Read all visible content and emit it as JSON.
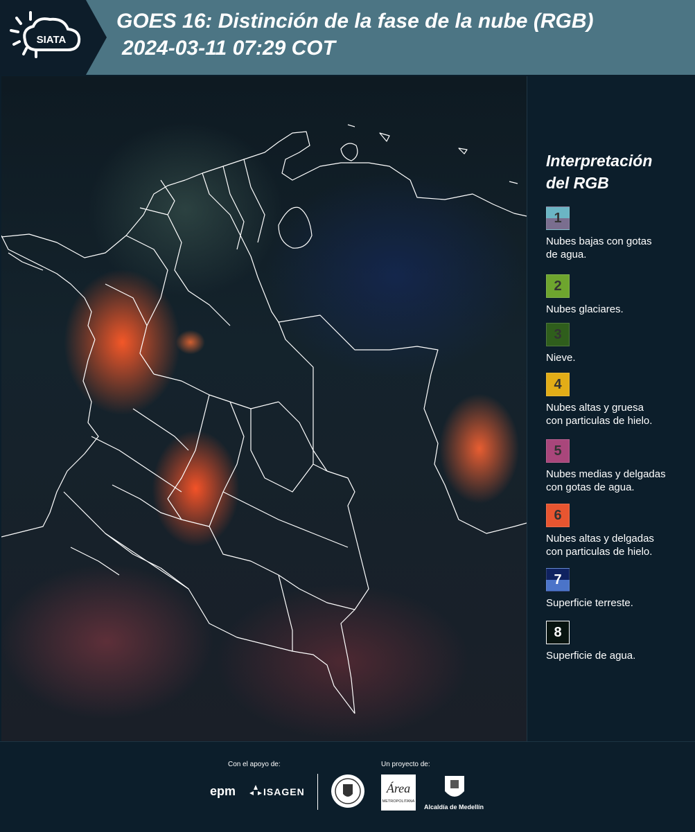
{
  "header": {
    "logo_text": "SIATA",
    "title_line1": "GOES 16: Distinción de la fase de la nube (RGB)",
    "title_line2": "2024-03-11 07:29 COT"
  },
  "legend": {
    "title_line1": "Interpretación",
    "title_line2": "del RGB",
    "items": [
      {
        "number": "1",
        "label_line1": "Nubes bajas con gotas",
        "label_line2": "de agua.",
        "color_top": "#6bb5c4",
        "color_bottom": "#7a6e8f"
      },
      {
        "number": "2",
        "label_line1": "Nubes glaciares.",
        "label_line2": "",
        "color_top": "#6ea52e",
        "color_bottom": "#6ea52e"
      },
      {
        "number": "3",
        "label_line1": "Nieve.",
        "label_line2": "",
        "color_top": "#2f5e1c",
        "color_bottom": "#2f5e1c"
      },
      {
        "number": "4",
        "label_line1": "Nubes altas y gruesa",
        "label_line2": "con particulas de hielo.",
        "color_top": "#e2ad17",
        "color_bottom": "#e2ad17"
      },
      {
        "number": "5",
        "label_line1": "Nubes medias y delgadas",
        "label_line2": "con gotas de agua.",
        "color_top": "#a9467b",
        "color_bottom": "#a9467b"
      },
      {
        "number": "6",
        "label_line1": "Nubes altas y delgadas",
        "label_line2": "con particulas de hielo.",
        "color_top": "#e85530",
        "color_bottom": "#e85530"
      },
      {
        "number": "7",
        "label_line1": "Superficie terreste.",
        "label_line2": "",
        "color_top": "#0f2260",
        "color_bottom": "#4b74c9"
      },
      {
        "number": "8",
        "label_line1": "Superficie de agua.",
        "label_line2": "",
        "color_top": "#081410",
        "color_bottom": "#081410"
      }
    ]
  },
  "footer": {
    "support_label": "Con el apoyo de:",
    "project_label": "Un proyecto de:",
    "epm": "epm",
    "isagen": "ISAGEN",
    "area_metropolitana": "METROPOLITANA",
    "alcaldia": "Alcaldía de Medellín"
  }
}
